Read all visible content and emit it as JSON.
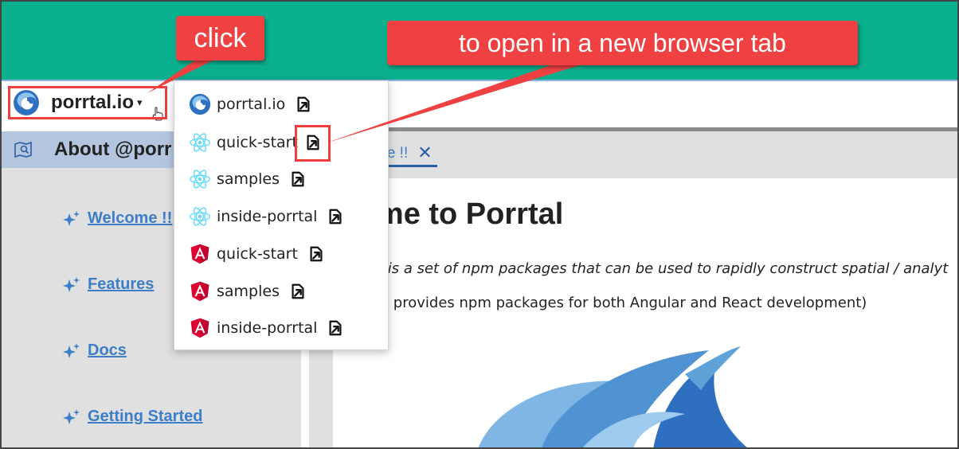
{
  "brand": {
    "name": "porrtal.io",
    "caret": "▾"
  },
  "annotations": {
    "click_label": "click",
    "new_tab_label": "to open in a new browser tab"
  },
  "dropdown": {
    "items": [
      {
        "label": "porrtal.io",
        "framework": "porrtal"
      },
      {
        "label": "quick-start",
        "framework": "react"
      },
      {
        "label": "samples",
        "framework": "react"
      },
      {
        "label": "inside-porrtal",
        "framework": "react"
      },
      {
        "label": "quick-start",
        "framework": "angular"
      },
      {
        "label": "samples",
        "framework": "angular"
      },
      {
        "label": "inside-porrtal",
        "framework": "angular"
      }
    ]
  },
  "sidebar": {
    "title": "About @porr",
    "items": [
      {
        "label": "Welcome !!"
      },
      {
        "label": "Features"
      },
      {
        "label": "Docs"
      },
      {
        "label": "Getting Started"
      }
    ]
  },
  "main": {
    "tab_label": "me !!",
    "tab_close": "✕",
    "title": "lcome to Porrtal",
    "line1": "al is a set of npm packages that can be used to rapidly construct spatial / analyt",
    "line2": "tal provides npm packages for both Angular and React development)"
  },
  "colors": {
    "header": "#0aaf8e",
    "callout": "#ef4141",
    "link": "#3c7ec7",
    "sidebar_header": "#b4c6df",
    "react": "#61dafb",
    "angular": "#dd0031"
  }
}
